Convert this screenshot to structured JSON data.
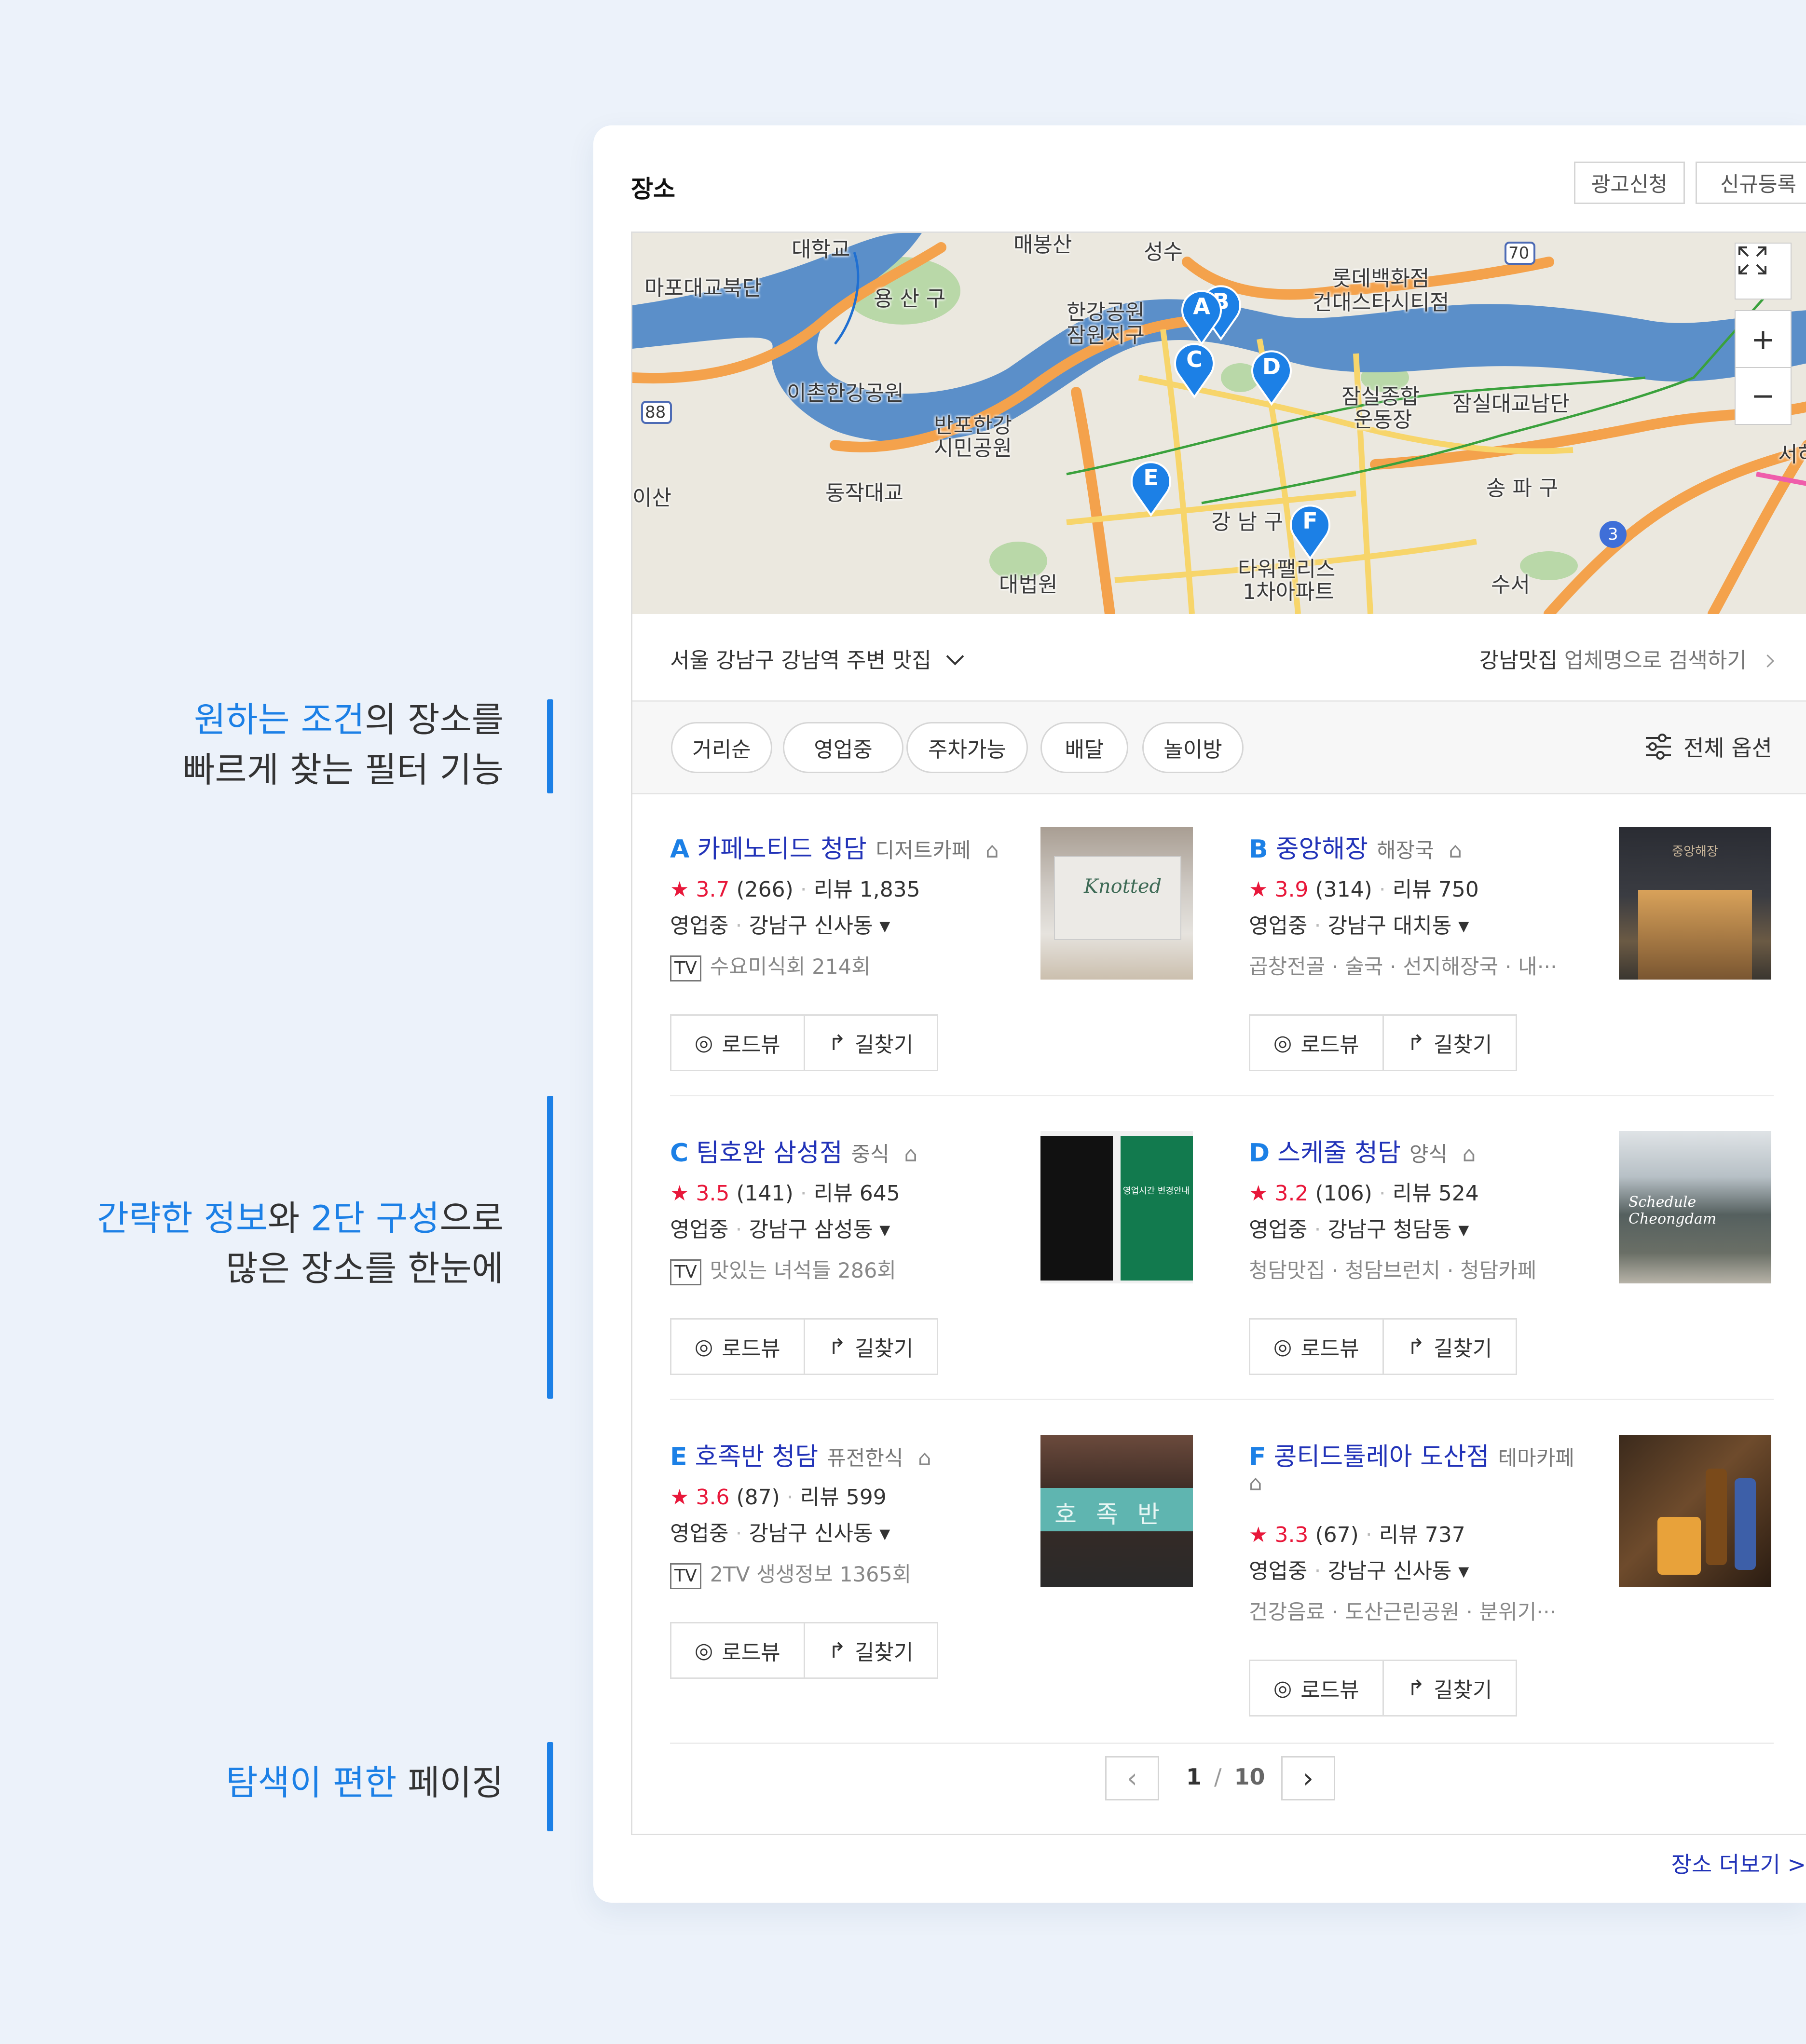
{
  "annotations": [
    {
      "pre_hl": "원하는 조건",
      "post": "의 장소를",
      "line2": "빠르게 찾는 필터 기능"
    },
    {
      "hl1": "간략한 정보",
      "mid": "와 ",
      "hl2": "2단 구성",
      "post": "으로",
      "line2": "많은 장소를 한눈에"
    },
    {
      "hl": "탐색이 편한",
      "post": " 페이징"
    }
  ],
  "header": {
    "title": "장소",
    "ad_button": "광고신청",
    "register_button": "신규등록"
  },
  "map": {
    "labels": [
      "마포대교북단",
      "용 산 구",
      "매봉산",
      "성수",
      "롯데백화점",
      "건대스타시티점",
      "한강공원",
      "잠원지구",
      "이촌한강공원",
      "반포한강",
      "시민공원",
      "동작대교",
      "잠실종합",
      "운동장",
      "잠실대교남단",
      "송 파 구",
      "강 남 구",
      "타워팰리스",
      "1차아파트",
      "대법원",
      "수서",
      "서히",
      "이산",
      "대학교"
    ],
    "road_signs": [
      "88",
      "70",
      "3"
    ],
    "pins": [
      "A",
      "B",
      "C",
      "D",
      "E",
      "F"
    ],
    "zoom_in": "+",
    "zoom_out": "−"
  },
  "location": {
    "label": "서울 강남구 강남역 주변 맛집",
    "search_bold": "강남맛집",
    "search_rest": " 업체명으로 검색하기"
  },
  "filters": {
    "chips": [
      "거리순",
      "영업중",
      "주차가능",
      "배달",
      "놀이방"
    ],
    "all_options": "전체 옵션"
  },
  "places": [
    {
      "letter": "A",
      "name": "카페노티드 청담",
      "category": "디저트카페",
      "score": "3.7",
      "score_count": "(266)",
      "reviews": "리뷰 1,835",
      "status": "영업중",
      "area": "강남구 신사동 ▾",
      "tv": "TV",
      "extra": "수요미식회 214회",
      "thumb_text": "Knotted"
    },
    {
      "letter": "B",
      "name": "중앙해장",
      "category": "해장국",
      "score": "3.9",
      "score_count": "(314)",
      "reviews": "리뷰 750",
      "status": "영업중",
      "area": "강남구 대치동 ▾",
      "tv": "",
      "extra": "곱창전골 · 술국 · 선지해장국 · 내···",
      "thumb_text": "중앙해장"
    },
    {
      "letter": "C",
      "name": "팀호완 삼성점",
      "category": "중식",
      "score": "3.5",
      "score_count": "(141)",
      "reviews": "리뷰 645",
      "status": "영업중",
      "area": "강남구 삼성동 ▾",
      "tv": "TV",
      "extra": "맛있는 녀석들 286회",
      "thumb_text": "영업시간 변경안내"
    },
    {
      "letter": "D",
      "name": "스케줄 청담",
      "category": "양식",
      "score": "3.2",
      "score_count": "(106)",
      "reviews": "리뷰 524",
      "status": "영업중",
      "area": "강남구 청담동 ▾",
      "tv": "",
      "extra": "청담맛집 · 청담브런치 · 청담카페",
      "thumb_text": "Schedule Cheongdam"
    },
    {
      "letter": "E",
      "name": "호족반 청담",
      "category": "퓨전한식",
      "score": "3.6",
      "score_count": "(87)",
      "reviews": "리뷰 599",
      "status": "영업중",
      "area": "강남구 신사동 ▾",
      "tv": "TV",
      "extra": "2TV 생생정보 1365회",
      "thumb_text": "호족반"
    },
    {
      "letter": "F",
      "name": "콩티드툴레아 도산점",
      "category": "테마카페",
      "score": "3.3",
      "score_count": "(67)",
      "reviews": "리뷰 737",
      "status": "영업중",
      "area": "강남구 신사동 ▾",
      "tv": "",
      "extra": "건강음료 · 도산근린공원 · 분위기···",
      "thumb_text": ""
    }
  ],
  "buttons": {
    "roadview": "로드뷰",
    "directions": "길찾기"
  },
  "pager": {
    "current": "1",
    "sep": "/",
    "total": "10"
  },
  "more_link": "장소 더보기 >",
  "colors": {
    "accent": "#1c80e6",
    "name": "#2233b8",
    "star": "#e8173a",
    "water": "#5b8fc9",
    "road": "#f4a24c"
  }
}
